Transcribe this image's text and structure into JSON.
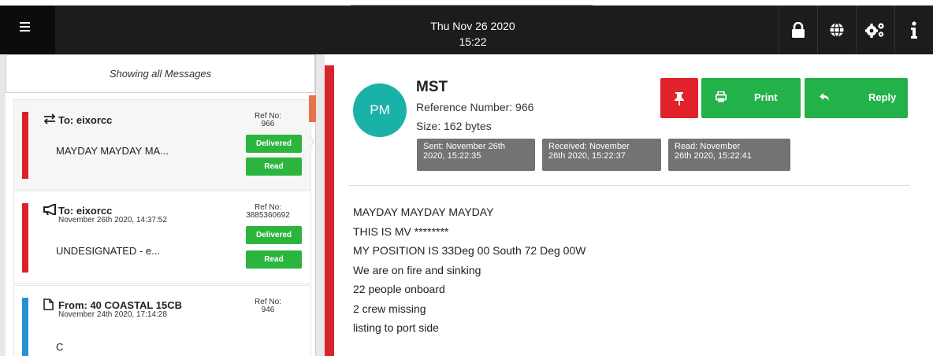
{
  "topbar": {
    "date": "Thu Nov 26 2020",
    "time": "15:22",
    "icons": [
      "menu-icon",
      "lock-icon",
      "globe-icon",
      "gears-icon",
      "info-icon"
    ]
  },
  "list": {
    "header": "Showing all Messages",
    "messages": [
      {
        "direction_icon": "exchange-icon",
        "to": "To: eixorcc",
        "sub": "",
        "ref_label": "Ref No:",
        "ref": "966",
        "body": "MAYDAY MAYDAY MA...",
        "status1": "Delivered",
        "status2": "Read",
        "bar_color": "#d9232a"
      },
      {
        "direction_icon": "bullhorn-icon",
        "to": "To: eixorcc",
        "sub": "November 26th 2020, 14:37:52",
        "ref_label": "Ref No:",
        "ref": "3885360692",
        "body": "UNDESIGNATED - e...",
        "status1": "Delivered",
        "status2": "Read",
        "bar_color": "#d9232a"
      },
      {
        "direction_icon": "document-icon",
        "to": "From: 40 COASTAL 15CB",
        "sub": "November 24th 2020, 17:14:28",
        "ref_label": "Ref No:",
        "ref": "946",
        "body": "C",
        "bar_color": "#2c8fd6"
      }
    ]
  },
  "detail": {
    "avatar": "PM",
    "subject": "MST",
    "reference": "Reference Number: 966",
    "size": "Size: 162 bytes",
    "sent": [
      "Sent: November 26th",
      "2020, 15:22:35"
    ],
    "received": [
      "Received: November",
      "26th 2020, 15:22:37"
    ],
    "read": [
      "Read: November",
      "26th 2020, 15:22:41"
    ],
    "print_label": "Print",
    "reply_label": "Reply",
    "lines": [
      "MAYDAY MAYDAY MAYDAY",
      "THIS IS MV ********",
      "MY POSITION IS 33Deg 00 South 72 Deg 00W",
      "We are on fire and sinking",
      "22 people onboard",
      "2 crew missing",
      "listing to port side"
    ]
  },
  "colors": {
    "accent_green": "#23b14a",
    "pin_red": "#e0232a",
    "avatar_teal": "#1ab1a8",
    "stamp_grey": "#737373"
  }
}
